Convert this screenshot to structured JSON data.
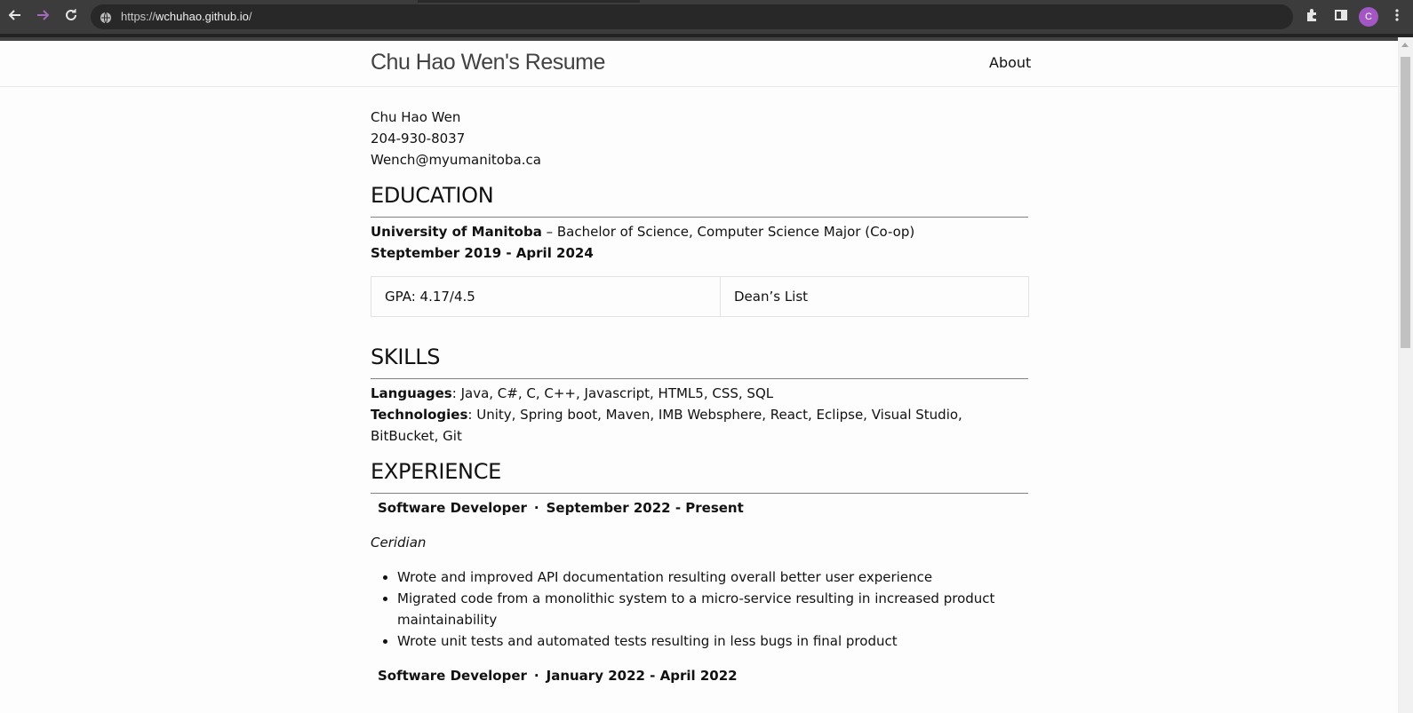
{
  "browser": {
    "url_scheme": "https://",
    "url_host": "wchuhao.github.io",
    "url_path": "/",
    "avatar_initial": "C"
  },
  "site": {
    "title": "Chu Hao Wen's Resume",
    "nav": {
      "about": "About"
    }
  },
  "contact": {
    "name": "Chu Hao Wen",
    "phone": "204-930-8037",
    "email": "Wench@myumanitoba.ca"
  },
  "education": {
    "heading": "EDUCATION",
    "school": "University of Manitoba",
    "degree": " – Bachelor of Science, Computer Science Major (Co-op)",
    "dates": "Steptember 2019 - April 2024",
    "gpa": "GPA: 4.17/4.5",
    "honor": "Dean’s List"
  },
  "skills": {
    "heading": "SKILLS",
    "languages_label": "Languages",
    "languages": ": Java, C#, C, C++, Javascript, HTML5, CSS, SQL",
    "technologies_label": "Technologies",
    "technologies": ": Unity, Spring boot, Maven, IMB Websphere, React, Eclipse, Visual Studio, BitBucket, Git"
  },
  "experience": {
    "heading": "EXPERIENCE",
    "jobs": [
      {
        "title": "Software Developer",
        "separator": "·",
        "dates": "September 2022 - Present",
        "company": "Ceridian",
        "bullets": [
          "Wrote and improved API documentation resulting overall better user experience",
          "Migrated code from a monolithic system to a micro-service resulting in increased product maintainability",
          "Wrote unit tests and automated tests resulting in less bugs in final product"
        ]
      },
      {
        "title": "Software Developer",
        "separator": "·",
        "dates": "January 2022 - April 2022"
      }
    ]
  }
}
